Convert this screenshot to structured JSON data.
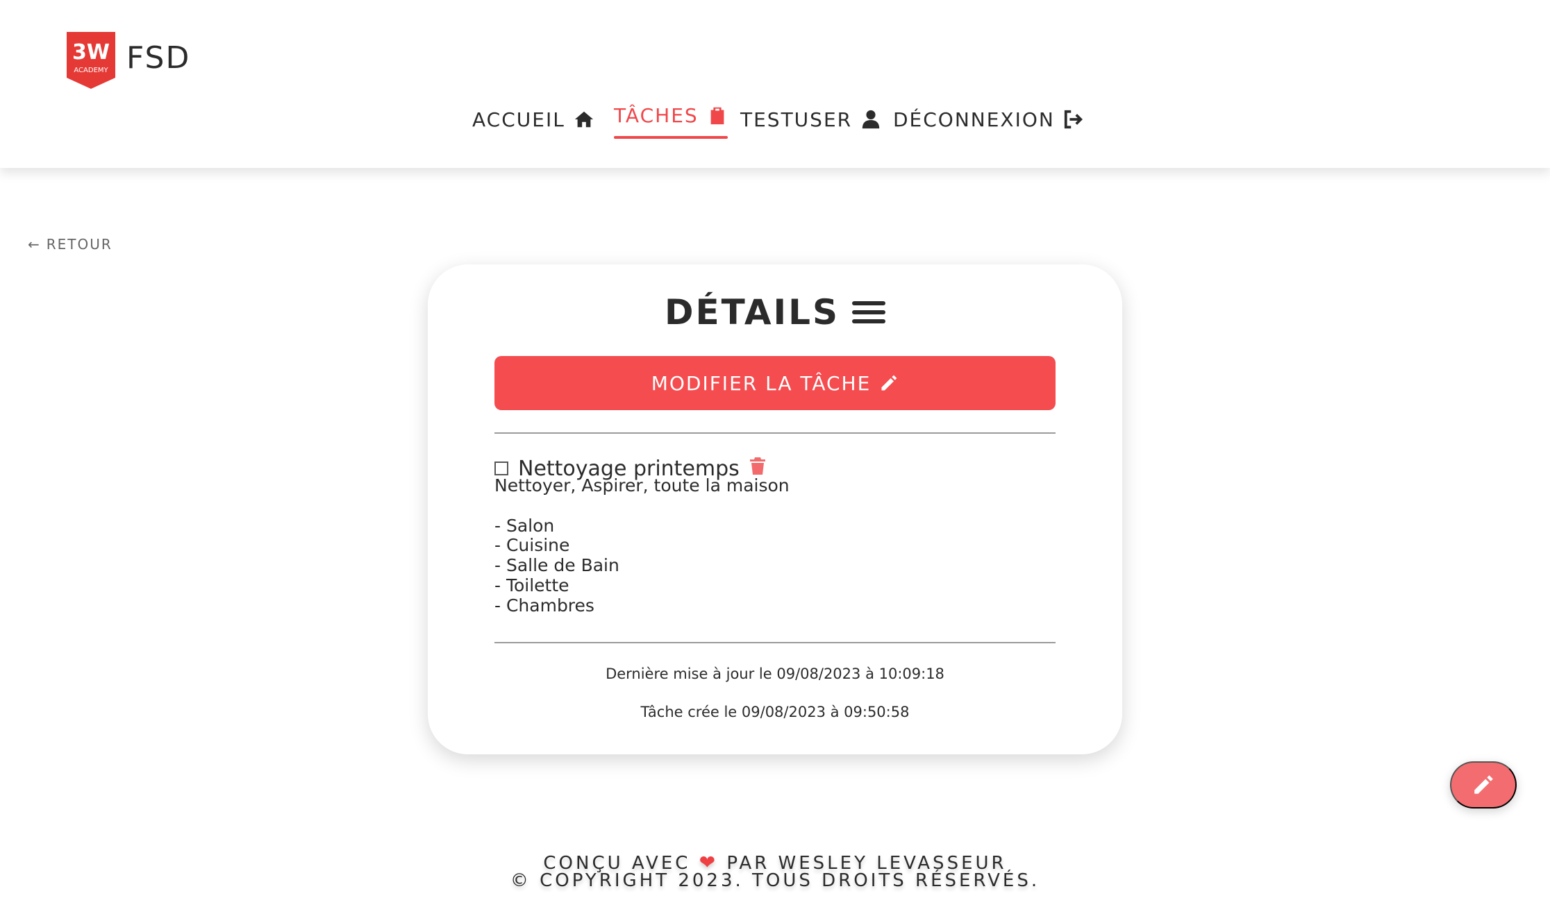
{
  "brand": {
    "name": "FSD",
    "logo_text": "3W",
    "logo_subtext": "ACADEMY"
  },
  "nav": {
    "items": [
      {
        "label": "ACCUEIL",
        "icon": "home-icon"
      },
      {
        "label": "TÂCHES",
        "icon": "clipboard-icon",
        "active": true
      },
      {
        "label": "TESTUSER",
        "icon": "user-icon"
      },
      {
        "label": "DÉCONNEXION",
        "icon": "logout-icon"
      }
    ]
  },
  "back": {
    "arrow": "←",
    "label": "RETOUR"
  },
  "card": {
    "title": "DÉTAILS",
    "edit_button": "MODIFIER LA TÂCHE",
    "task": {
      "title": "Nettoyage printemps",
      "description": "Nettoyer, Aspirer, toute la maison\n\n- Salon\n- Cuisine\n- Salle de Bain\n- Toilette\n- Chambres"
    },
    "updated": "Dernière mise à jour le 09/08/2023 à 10:09:18",
    "created": "Tâche crée le 09/08/2023 à 09:50:58"
  },
  "footer": {
    "line1_before": "CONÇU AVEC",
    "line1_after": "PAR WESLEY LEVASSEUR",
    "line2": "© COPYRIGHT 2023. TOUS DROITS RÉSERVÉS."
  },
  "colors": {
    "accent": "#f44c4f",
    "fab": "#f36d70",
    "trash": "#f26a6b"
  }
}
